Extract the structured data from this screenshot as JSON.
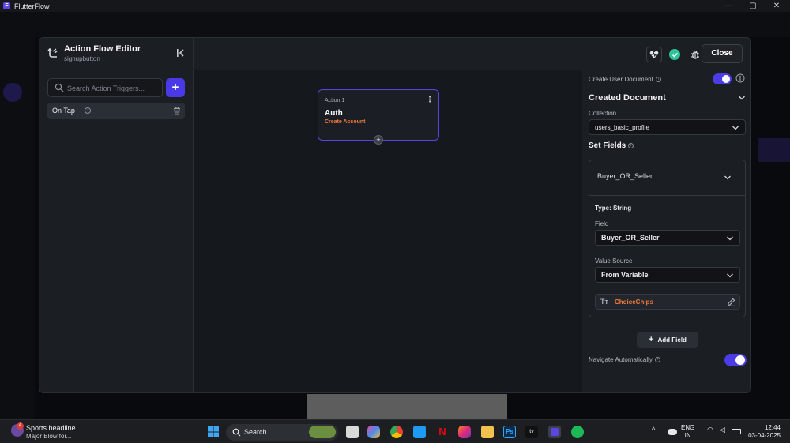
{
  "window": {
    "app_title": "FlutterFlow",
    "controls": [
      "—",
      "▢",
      "✕"
    ]
  },
  "editor": {
    "title": "Action Flow Editor",
    "subtitle": "signupbutton",
    "close_label": "Close"
  },
  "left_panel": {
    "search_placeholder": "Search Action Triggers...",
    "add_label": "+",
    "triggers": [
      {
        "label": "On Tap"
      }
    ]
  },
  "canvas": {
    "action": {
      "number_label": "Action 1",
      "title": "Auth",
      "subtitle": "Create Account",
      "add_label": "+"
    }
  },
  "right_panel": {
    "create_user_document_label": "Create User Document",
    "create_user_document_on": true,
    "created_document_title": "Created Document",
    "collection_label": "Collection",
    "collection_value": "users_basic_profile",
    "set_fields_label": "Set Fields",
    "field_header": "Buyer_OR_Seller",
    "type_label": "Type: String",
    "field_label": "Field",
    "field_value": "Buyer_OR_Seller",
    "value_source_label": "Value Source",
    "value_source_value": "From Variable",
    "variable_icon_text": "Tт",
    "variable_value": "ChoiceChips",
    "add_field_label": "Add Field",
    "navigate_automatically_label": "Navigate Automatically",
    "navigate_automatically_on": true
  },
  "colors": {
    "accent": "#4b3ce6",
    "action_sub": "#f27b3c",
    "success": "#2fc29b"
  },
  "taskbar": {
    "news_badge": "4",
    "news_title": "Sports headline",
    "news_text": "Major Blow for...",
    "search_label": "Search",
    "lang_top": "ENG",
    "lang_bottom": "IN",
    "time": "12:44",
    "date": "03-04-2025"
  }
}
